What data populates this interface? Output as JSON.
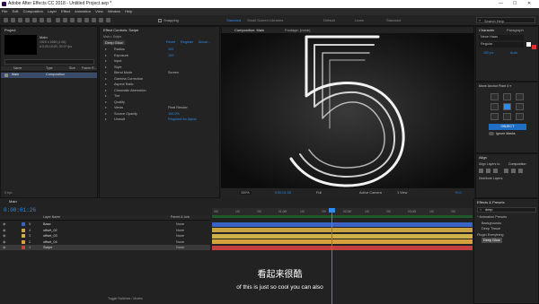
{
  "window": {
    "title": "Adobe After Effects CC 2018 - Untitled Project.aep *",
    "controls": [
      "—",
      "☐",
      "✕"
    ]
  },
  "menu": [
    "File",
    "Edit",
    "Composition",
    "Layer",
    "Effect",
    "Animation",
    "View",
    "Window",
    "Help"
  ],
  "toolbar": {
    "snapping_label": "Snapping",
    "workspaces": [
      "Default",
      "Learn",
      "Standard",
      "Small Screen",
      "Libraries"
    ],
    "workspace_active": "Standard",
    "search_placeholder": "Search Help"
  },
  "project": {
    "tab": "Project",
    "comp_name": "Main",
    "comp_info": "1920 x 1080 (1.00)",
    "comp_dur": "Δ 0;00;10;00, 29.97 fps",
    "col_name": "Name",
    "col_type": "Type",
    "col_size": "Size",
    "col_frame": "Frame R...",
    "item_name": "Main",
    "item_type": "Composition",
    "footer": "8 bpc"
  },
  "effect_controls": {
    "tab": "Effect Controls: Swipe",
    "path": "Main • Swipe",
    "effect_name": "Deep Glow",
    "reset": "Reset",
    "register": "Register",
    "about": "About...",
    "params": [
      {
        "name": "Radius",
        "value": "100"
      },
      {
        "name": "Exposure",
        "value": "100"
      },
      {
        "name": "Input",
        "value": ""
      },
      {
        "name": "Style",
        "value": ""
      },
      {
        "name": "Blend Mode",
        "value": "Screen"
      },
      {
        "name": "Gamma Correction",
        "value": ""
      },
      {
        "name": "Aspect Ratio",
        "value": ""
      },
      {
        "name": "Chromatic Aberration",
        "value": ""
      },
      {
        "name": "Tint",
        "value": ""
      },
      {
        "name": "Quality",
        "value": ""
      },
      {
        "name": "Views",
        "value": "Final Render"
      },
      {
        "name": "Source Opacity",
        "value": "100.0%"
      },
      {
        "name": "Unmult",
        "value": "Required for Alpha"
      }
    ]
  },
  "composition": {
    "tab": "Composition: Main",
    "footage_tab": "Footage: (none)",
    "comp_label": "Main",
    "digit": "5",
    "zoom": "100%",
    "timecode": "0;00;01;26",
    "resolution": "Full",
    "camera": "Active Camera",
    "views": "1 View"
  },
  "character": {
    "tab": "Character",
    "tab2": "Paragraph",
    "font": "Neue Haas",
    "style": "Regular",
    "size": "100 px",
    "leading": "Auto"
  },
  "plugin_panel": {
    "title": "Move Anchor Point 4 ≡",
    "button": "OBJECT",
    "toggle_label": "Ignore Masks"
  },
  "align": {
    "tab": "Align",
    "align_to_label": "Align Layers to:",
    "align_to_value": "Composition",
    "distribute_label": "Distribute Layers:"
  },
  "timeline": {
    "tab": "Main",
    "timecode": "0:00:01:26",
    "col_layer": "Layer Name",
    "col_parent": "Parent & Link",
    "rulers": [
      "00f",
      "10f",
      "20f",
      "01:00f",
      "10f",
      "20f",
      "02:00f",
      "10f",
      "20f",
      "03:00f",
      "10f",
      "20f"
    ],
    "layers": [
      {
        "num": "1",
        "name": "Swipe",
        "parent": "None",
        "color": "#c3403f"
      },
      {
        "num": "2",
        "name": "offset_04",
        "parent": "None",
        "color": "#d6a23b"
      },
      {
        "num": "3",
        "name": "offset_03",
        "parent": "None",
        "color": "#cdb24a"
      },
      {
        "num": "4",
        "name": "offset_02",
        "parent": "None",
        "color": "#c9a241"
      },
      {
        "num": "5",
        "name": "Base",
        "parent": "None",
        "color": "#3a63c7"
      }
    ],
    "footer": "Toggle Switches / Modes",
    "subtitle_cn": "看起来很酷",
    "subtitle_en": "of this is just so cool you can also"
  },
  "effects_presets": {
    "tab": "Effects & Presets",
    "search_value": "deep",
    "items": [
      "* Animation Presets",
      "Backgrounds",
      "Deep Tissue",
      "Plugin Everything",
      "Deep Glow"
    ]
  },
  "colors": {
    "accent_blue": "#2d8ceb",
    "panel_bg": "#232323",
    "tab_active": "#dcdcdc"
  }
}
